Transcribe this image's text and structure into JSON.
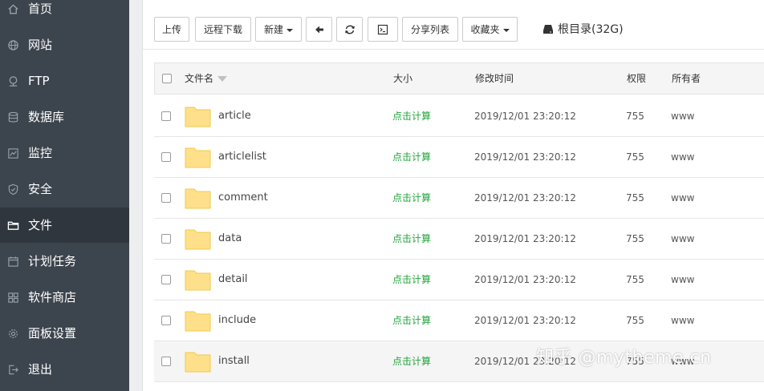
{
  "sidebar": {
    "items": [
      {
        "label": "首页",
        "icon": "home-icon"
      },
      {
        "label": "网站",
        "icon": "globe-icon"
      },
      {
        "label": "FTP",
        "icon": "ftp-icon"
      },
      {
        "label": "数据库",
        "icon": "database-icon"
      },
      {
        "label": "监控",
        "icon": "monitor-icon"
      },
      {
        "label": "安全",
        "icon": "shield-icon"
      },
      {
        "label": "文件",
        "icon": "folder-icon",
        "active": true
      },
      {
        "label": "计划任务",
        "icon": "calendar-icon"
      },
      {
        "label": "软件商店",
        "icon": "grid-icon"
      },
      {
        "label": "面板设置",
        "icon": "gear-icon"
      },
      {
        "label": "退出",
        "icon": "logout-icon"
      }
    ]
  },
  "toolbar": {
    "upload": "上传",
    "remote_download": "远程下载",
    "new": "新建",
    "share_list": "分享列表",
    "favorites": "收藏夹",
    "root_dir": "根目录(32G)"
  },
  "table": {
    "headers": {
      "name": "文件名",
      "size": "大小",
      "mtime": "修改时间",
      "perm": "权限",
      "owner": "所有者"
    },
    "rows": [
      {
        "name": "article",
        "size": "点击计算",
        "mtime": "2019/12/01 23:20:12",
        "perm": "755",
        "owner": "www"
      },
      {
        "name": "articlelist",
        "size": "点击计算",
        "mtime": "2019/12/01 23:20:12",
        "perm": "755",
        "owner": "www"
      },
      {
        "name": "comment",
        "size": "点击计算",
        "mtime": "2019/12/01 23:20:12",
        "perm": "755",
        "owner": "www"
      },
      {
        "name": "data",
        "size": "点击计算",
        "mtime": "2019/12/01 23:20:12",
        "perm": "755",
        "owner": "www"
      },
      {
        "name": "detail",
        "size": "点击计算",
        "mtime": "2019/12/01 23:20:12",
        "perm": "755",
        "owner": "www"
      },
      {
        "name": "include",
        "size": "点击计算",
        "mtime": "2019/12/01 23:20:12",
        "perm": "755",
        "owner": "www"
      },
      {
        "name": "install",
        "size": "点击计算",
        "mtime": "2019/12/01 23:20:12",
        "perm": "755",
        "owner": "www"
      }
    ]
  },
  "watermark": "知乎 @mytheme.cn",
  "colors": {
    "sidebar_bg": "#3c444d",
    "sidebar_active": "#2f363d",
    "size_link": "#20a53a",
    "folder": "#ffe08a"
  }
}
